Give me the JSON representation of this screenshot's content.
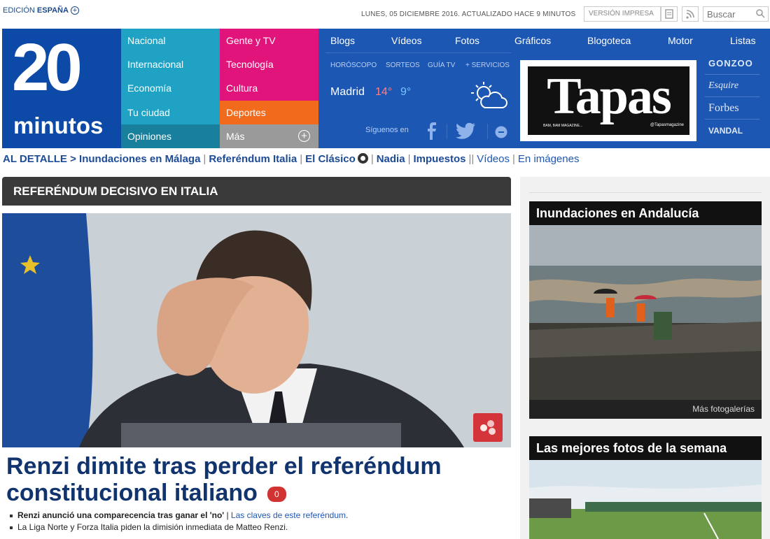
{
  "topbar": {
    "edition_label": "EDICIÓN",
    "edition_country": "ESPAÑA",
    "date_text": "LUNES, 05 DICIEMBRE 2016. ACTUALIZADO HACE 9 MINUTOS",
    "print_label": "VERSIÓN IMPRESA",
    "search_placeholder": "Buscar"
  },
  "logo": {
    "number": "20",
    "word": "minutos"
  },
  "nav": {
    "col1": [
      "Nacional",
      "Internacional",
      "Economía",
      "Tu ciudad",
      "Opiniones"
    ],
    "col2": [
      "Gente y TV",
      "Tecnología",
      "Cultura",
      "Deportes",
      "Más"
    ],
    "top": [
      "Blogs",
      "Vídeos",
      "Fotos",
      "Gráficos",
      "Blogoteca",
      "Motor",
      "Listas"
    ],
    "sub": [
      "HORÓSCOPO",
      "SORTEOS",
      "GUÍA TV",
      "+ SERVICIOS"
    ]
  },
  "weather": {
    "city": "Madrid",
    "high": "14°",
    "low": "9°"
  },
  "social": {
    "follow_label": "Síguenos en"
  },
  "ad": {
    "title": "Tapas",
    "subtitle": "BAM, BAM MAGAZINE...",
    "handle": "@Tapasmagazine"
  },
  "brands": [
    "GONZOO",
    "Esquire",
    "Forbes",
    "VANDAL"
  ],
  "trending": {
    "prefix": "AL DETALLE >",
    "items": [
      "Inundaciones en Málaga",
      "Referéndum Italia",
      "El Clásico",
      "Nadia",
      "Impuestos"
    ],
    "extra": [
      "Vídeos",
      "En imágenes"
    ]
  },
  "main": {
    "section_title": "REFERÉNDUM DECISIVO EN ITALIA",
    "headline": "Renzi dimite tras perder el referéndum constitucional italiano",
    "comment_count": "0",
    "bullet1_bold": "Renzi anunció una comparecencia tras ganar el 'no'",
    "bullet1_sep": " | ",
    "bullet1_link": "Las claves de este referéndum",
    "bullet1_end": ".",
    "bullet2": "La Liga Norte y Forza Italia piden la dimisión inmediata de Matteo Renzi."
  },
  "sidebar": {
    "card1_title": "Inundaciones en Andalucía",
    "card1_more": "Más fotogalerías",
    "card2_title": "Las mejores fotos de la semana"
  },
  "colors": {
    "brand_blue": "#1d57b4",
    "nav_teal": "#1fa2c4",
    "nav_magenta": "#e0147b",
    "nav_orange": "#f26a1c",
    "headline_navy": "#12346e"
  }
}
